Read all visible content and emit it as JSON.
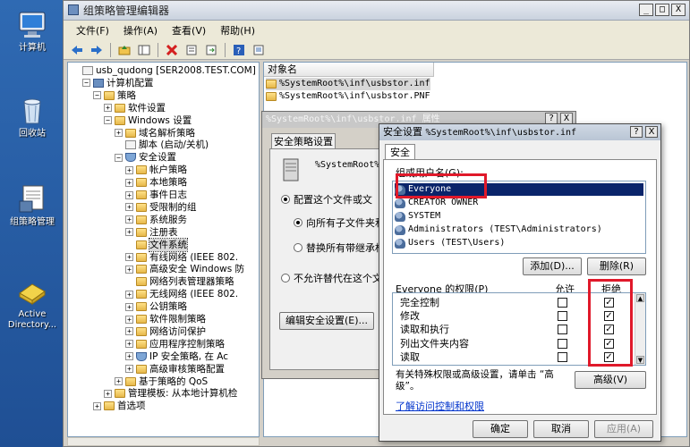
{
  "desktop": {
    "icons": [
      {
        "label": "计算机"
      },
      {
        "label": "回收站"
      },
      {
        "label": "组策略管理"
      },
      {
        "label": "Active Directory..."
      }
    ]
  },
  "window": {
    "title": "组策略管理编辑器",
    "controls": [
      "_",
      "□",
      "X"
    ]
  },
  "menu": [
    "文件(F)",
    "操作(A)",
    "查看(V)",
    "帮助(H)"
  ],
  "tree": [
    {
      "label": "usb_qudong [SER2008.TEST.COM] 策略",
      "level": 0,
      "icon": "doc",
      "exp": ""
    },
    {
      "label": "计算机配置",
      "level": 1,
      "icon": "pc",
      "exp": "-"
    },
    {
      "label": "策略",
      "level": 2,
      "icon": "folder",
      "exp": "-"
    },
    {
      "label": "软件设置",
      "level": 3,
      "icon": "folder",
      "exp": "+"
    },
    {
      "label": "Windows 设置",
      "level": 3,
      "icon": "folder",
      "exp": "-"
    },
    {
      "label": "域名解析策略",
      "level": 4,
      "icon": "folder",
      "exp": "+"
    },
    {
      "label": "脚本 (启动/关机)",
      "level": 4,
      "icon": "doc",
      "exp": ""
    },
    {
      "label": "安全设置",
      "level": 4,
      "icon": "shield",
      "exp": "-"
    },
    {
      "label": "帐户策略",
      "level": 5,
      "icon": "folder",
      "exp": "+"
    },
    {
      "label": "本地策略",
      "level": 5,
      "icon": "folder",
      "exp": "+"
    },
    {
      "label": "事件日志",
      "level": 5,
      "icon": "folder",
      "exp": "+"
    },
    {
      "label": "受限制的组",
      "level": 5,
      "icon": "folder",
      "exp": "+"
    },
    {
      "label": "系统服务",
      "level": 5,
      "icon": "folder",
      "exp": "+"
    },
    {
      "label": "注册表",
      "level": 5,
      "icon": "folder",
      "exp": "+"
    },
    {
      "label": "文件系统",
      "level": 5,
      "icon": "folder",
      "exp": "",
      "selected": true
    },
    {
      "label": "有线网络 (IEEE 802.",
      "level": 5,
      "icon": "folder",
      "exp": "+"
    },
    {
      "label": "高级安全 Windows 防",
      "level": 5,
      "icon": "folder",
      "exp": "+"
    },
    {
      "label": "网络列表管理器策略",
      "level": 5,
      "icon": "folder",
      "exp": ""
    },
    {
      "label": "无线网络 (IEEE 802.",
      "level": 5,
      "icon": "folder",
      "exp": "+"
    },
    {
      "label": "公钥策略",
      "level": 5,
      "icon": "folder",
      "exp": "+"
    },
    {
      "label": "软件限制策略",
      "level": 5,
      "icon": "folder",
      "exp": "+"
    },
    {
      "label": "网络访问保护",
      "level": 5,
      "icon": "folder",
      "exp": "+"
    },
    {
      "label": "应用程序控制策略",
      "level": 5,
      "icon": "folder",
      "exp": "+"
    },
    {
      "label": "IP 安全策略, 在 Ac",
      "level": 5,
      "icon": "shield",
      "exp": "+"
    },
    {
      "label": "高级审核策略配置",
      "level": 5,
      "icon": "folder",
      "exp": "+"
    },
    {
      "label": "基于策略的 QoS",
      "level": 4,
      "icon": "folder",
      "exp": "+"
    },
    {
      "label": "管理模板: 从本地计算机检",
      "level": 3,
      "icon": "folder",
      "exp": "+"
    },
    {
      "label": "首选项",
      "level": 2,
      "icon": "folder",
      "exp": "+"
    }
  ],
  "list": {
    "header": "对象名",
    "rows": [
      {
        "label": "%SystemRoot%\\inf\\usbstor.inf",
        "selected": true
      },
      {
        "label": "%SystemRoot%\\inf\\usbstor.PNF",
        "selected": false
      }
    ]
  },
  "prop_dialog": {
    "title": "%SystemRoot%\\inf\\usbstor.inf 属性",
    "tab": "安全策略设置",
    "path": "%SystemRoot%\\",
    "option1": "配置这个文件或文",
    "option1a": "向所有子文件夹和",
    "option1b": "替换所有带继承权",
    "option2": "不允许替代在这个文",
    "edit_button": "编辑安全设置(E)..."
  },
  "sec_dialog": {
    "title_prefix": "安全设置",
    "title_path": "%SystemRoot%\\inf\\usbstor.inf",
    "tab": "安全",
    "group_label": "组或用户名(G):",
    "users": [
      {
        "name": "Everyone",
        "selected": true
      },
      {
        "name": "CREATOR OWNER",
        "selected": false
      },
      {
        "name": "SYSTEM",
        "selected": false
      },
      {
        "name": "Administrators (TEST\\Administrators)",
        "selected": false
      },
      {
        "name": "Users (TEST\\Users)",
        "selected": false
      }
    ],
    "add_button": "添加(D)...",
    "remove_button": "删除(R)",
    "perm_label": "Everyone 的权限(P)",
    "allow_col": "允许",
    "deny_col": "拒绝",
    "permissions": [
      {
        "name": "完全控制",
        "allow": false,
        "deny": true
      },
      {
        "name": "修改",
        "allow": false,
        "deny": true
      },
      {
        "name": "读取和执行",
        "allow": false,
        "deny": true
      },
      {
        "name": "列出文件夹内容",
        "allow": false,
        "deny": true
      },
      {
        "name": "读取",
        "allow": false,
        "deny": true
      }
    ],
    "advanced_note": "有关特殊权限或高级设置，请单击 “高级”。",
    "advanced_button": "高级(V)",
    "learn_link": "了解访问控制和权限",
    "ok": "确定",
    "cancel": "取消",
    "apply": "应用(A)"
  },
  "colors": {
    "highlight_red": "#e0192a",
    "selection_blue": "#0a246a"
  }
}
